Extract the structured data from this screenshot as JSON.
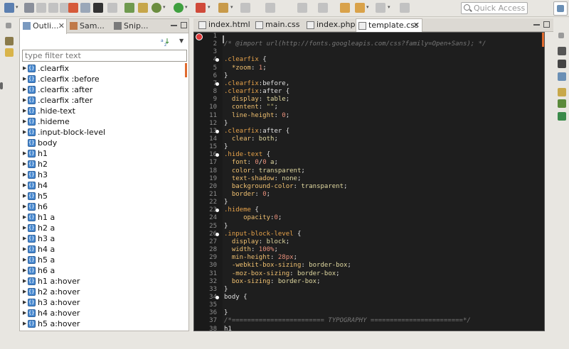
{
  "toolbar": {
    "quick_access_placeholder": "Quick Access"
  },
  "outline": {
    "tabs": [
      {
        "label": "Outli...",
        "close": "✕"
      },
      {
        "label": "Sam..."
      },
      {
        "label": "Snip..."
      }
    ],
    "filter_placeholder": "type filter text",
    "items": [
      {
        "label": ".clearfix",
        "expandable": true
      },
      {
        "label": ".clearfix :before",
        "expandable": true
      },
      {
        "label": ".clearfix :after",
        "expandable": true
      },
      {
        "label": ".clearfix :after",
        "expandable": true
      },
      {
        "label": ".hide-text",
        "expandable": true
      },
      {
        "label": ".hideme",
        "expandable": true
      },
      {
        "label": ".input-block-level",
        "expandable": true
      },
      {
        "label": "body",
        "expandable": false
      },
      {
        "label": "h1",
        "expandable": true
      },
      {
        "label": "h2",
        "expandable": true
      },
      {
        "label": "h3",
        "expandable": true
      },
      {
        "label": "h4",
        "expandable": true
      },
      {
        "label": "h5",
        "expandable": true
      },
      {
        "label": "h6",
        "expandable": true
      },
      {
        "label": "h1 a",
        "expandable": true
      },
      {
        "label": "h2 a",
        "expandable": true
      },
      {
        "label": "h3 a",
        "expandable": true
      },
      {
        "label": "h4 a",
        "expandable": true
      },
      {
        "label": "h5 a",
        "expandable": true
      },
      {
        "label": "h6 a",
        "expandable": true
      },
      {
        "label": "h1 a:hover",
        "expandable": true
      },
      {
        "label": "h2 a:hover",
        "expandable": true
      },
      {
        "label": "h3 a:hover",
        "expandable": true
      },
      {
        "label": "h4 a:hover",
        "expandable": true
      },
      {
        "label": "h5 a:hover",
        "expandable": true
      }
    ]
  },
  "editor": {
    "tabs": [
      {
        "label": "index.html"
      },
      {
        "label": "main.css"
      },
      {
        "label": "index.php"
      },
      {
        "label": "template.css",
        "active": true,
        "close": "✕"
      }
    ],
    "lines": [
      {
        "n": "1",
        "fold": false,
        "segs": []
      },
      {
        "n": "2",
        "fold": false,
        "segs": [
          [
            "c-com",
            "/* @import url(http://fonts.googleapis.com/css?family=Open+Sans); */"
          ]
        ]
      },
      {
        "n": "3",
        "fold": false,
        "segs": []
      },
      {
        "n": "4",
        "fold": true,
        "segs": [
          [
            "c-sel",
            ".clearfix"
          ],
          [
            "c-punc",
            " {"
          ]
        ]
      },
      {
        "n": "5",
        "fold": false,
        "segs": [
          [
            "c-prop",
            "  *zoom"
          ],
          [
            "c-punc",
            ": "
          ],
          [
            "c-num",
            "1"
          ],
          [
            "c-punc",
            ";"
          ]
        ]
      },
      {
        "n": "6",
        "fold": false,
        "segs": [
          [
            "c-punc",
            "}"
          ]
        ]
      },
      {
        "n": "7",
        "fold": true,
        "segs": [
          [
            "c-sel",
            ".clearfix"
          ],
          [
            "c-punc",
            ":before,"
          ]
        ]
      },
      {
        "n": "8",
        "fold": false,
        "segs": [
          [
            "c-sel",
            ".clearfix"
          ],
          [
            "c-punc",
            ":after {"
          ]
        ]
      },
      {
        "n": "9",
        "fold": false,
        "segs": [
          [
            "c-prop",
            "  display"
          ],
          [
            "c-punc",
            ": "
          ],
          [
            "c-val",
            "table"
          ],
          [
            "c-punc",
            ";"
          ]
        ]
      },
      {
        "n": "10",
        "fold": false,
        "segs": [
          [
            "c-prop",
            "  content"
          ],
          [
            "c-punc",
            ": "
          ],
          [
            "c-str",
            "\"\""
          ],
          [
            "c-punc",
            ";"
          ]
        ]
      },
      {
        "n": "11",
        "fold": false,
        "segs": [
          [
            "c-prop",
            "  line-height"
          ],
          [
            "c-punc",
            ": "
          ],
          [
            "c-num",
            "0"
          ],
          [
            "c-punc",
            ";"
          ]
        ]
      },
      {
        "n": "12",
        "fold": false,
        "segs": [
          [
            "c-punc",
            "}"
          ]
        ]
      },
      {
        "n": "13",
        "fold": true,
        "segs": [
          [
            "c-sel",
            ".clearfix"
          ],
          [
            "c-punc",
            ":after {"
          ]
        ]
      },
      {
        "n": "14",
        "fold": false,
        "segs": [
          [
            "c-prop",
            "  clear"
          ],
          [
            "c-punc",
            ": "
          ],
          [
            "c-val",
            "both"
          ],
          [
            "c-punc",
            ";"
          ]
        ]
      },
      {
        "n": "15",
        "fold": false,
        "segs": [
          [
            "c-punc",
            "}"
          ]
        ]
      },
      {
        "n": "16",
        "fold": true,
        "segs": [
          [
            "c-sel",
            ".hide-text"
          ],
          [
            "c-punc",
            " {"
          ]
        ]
      },
      {
        "n": "17",
        "fold": false,
        "segs": [
          [
            "c-prop",
            "  font"
          ],
          [
            "c-punc",
            ": "
          ],
          [
            "c-num",
            "0"
          ],
          [
            "c-punc",
            "/"
          ],
          [
            "c-num",
            "0"
          ],
          [
            "c-val",
            " a"
          ],
          [
            "c-punc",
            ";"
          ]
        ]
      },
      {
        "n": "18",
        "fold": false,
        "segs": [
          [
            "c-prop",
            "  color"
          ],
          [
            "c-punc",
            ": "
          ],
          [
            "c-val",
            "transparent"
          ],
          [
            "c-punc",
            ";"
          ]
        ]
      },
      {
        "n": "19",
        "fold": false,
        "segs": [
          [
            "c-prop",
            "  text-shadow"
          ],
          [
            "c-punc",
            ": "
          ],
          [
            "c-val",
            "none"
          ],
          [
            "c-punc",
            ";"
          ]
        ]
      },
      {
        "n": "20",
        "fold": false,
        "segs": [
          [
            "c-prop",
            "  background-color"
          ],
          [
            "c-punc",
            ": "
          ],
          [
            "c-val",
            "transparent"
          ],
          [
            "c-punc",
            ";"
          ]
        ]
      },
      {
        "n": "21",
        "fold": false,
        "segs": [
          [
            "c-prop",
            "  border"
          ],
          [
            "c-punc",
            ": "
          ],
          [
            "c-num",
            "0"
          ],
          [
            "c-punc",
            ";"
          ]
        ]
      },
      {
        "n": "22",
        "fold": false,
        "segs": [
          [
            "c-punc",
            "}"
          ]
        ]
      },
      {
        "n": "23",
        "fold": true,
        "segs": [
          [
            "c-sel",
            ".hideme"
          ],
          [
            "c-punc",
            " {"
          ]
        ]
      },
      {
        "n": "24",
        "fold": false,
        "segs": [
          [
            "c-prop",
            "     opacity"
          ],
          [
            "c-punc",
            ":"
          ],
          [
            "c-num",
            "0"
          ],
          [
            "c-punc",
            ";"
          ]
        ]
      },
      {
        "n": "25",
        "fold": false,
        "segs": [
          [
            "c-punc",
            "}"
          ]
        ]
      },
      {
        "n": "26",
        "fold": true,
        "segs": [
          [
            "c-sel",
            ".input-block-level"
          ],
          [
            "c-punc",
            " {"
          ]
        ]
      },
      {
        "n": "27",
        "fold": false,
        "segs": [
          [
            "c-prop",
            "  display"
          ],
          [
            "c-punc",
            ": "
          ],
          [
            "c-val",
            "block"
          ],
          [
            "c-punc",
            ";"
          ]
        ]
      },
      {
        "n": "28",
        "fold": false,
        "segs": [
          [
            "c-prop",
            "  width"
          ],
          [
            "c-punc",
            ": "
          ],
          [
            "c-num",
            "100%"
          ],
          [
            "c-punc",
            ";"
          ]
        ]
      },
      {
        "n": "29",
        "fold": false,
        "segs": [
          [
            "c-prop",
            "  min-height"
          ],
          [
            "c-punc",
            ": "
          ],
          [
            "c-num",
            "28px"
          ],
          [
            "c-punc",
            ";"
          ]
        ]
      },
      {
        "n": "30",
        "fold": false,
        "segs": [
          [
            "c-prop",
            "  -webkit-box-sizing"
          ],
          [
            "c-punc",
            ": "
          ],
          [
            "c-val",
            "border-box"
          ],
          [
            "c-punc",
            ";"
          ]
        ]
      },
      {
        "n": "31",
        "fold": false,
        "segs": [
          [
            "c-prop",
            "  -moz-box-sizing"
          ],
          [
            "c-punc",
            ": "
          ],
          [
            "c-val",
            "border-box"
          ],
          [
            "c-punc",
            ";"
          ]
        ]
      },
      {
        "n": "32",
        "fold": false,
        "segs": [
          [
            "c-prop",
            "  box-sizing"
          ],
          [
            "c-punc",
            ": "
          ],
          [
            "c-val",
            "border-box"
          ],
          [
            "c-punc",
            ";"
          ]
        ]
      },
      {
        "n": "33",
        "fold": false,
        "segs": [
          [
            "c-punc",
            "}"
          ]
        ]
      },
      {
        "n": "34",
        "fold": true,
        "segs": [
          [
            "c-punc",
            "body {"
          ]
        ]
      },
      {
        "n": "35",
        "fold": false,
        "segs": []
      },
      {
        "n": "36",
        "fold": false,
        "segs": [
          [
            "c-punc",
            "}"
          ]
        ]
      },
      {
        "n": "37",
        "fold": false,
        "segs": [
          [
            "c-com",
            "/*======================== TYPOGRAPHY ========================*/"
          ]
        ]
      },
      {
        "n": "38",
        "fold": false,
        "segs": [
          [
            "c-punc",
            "h1"
          ]
        ]
      }
    ]
  },
  "colors": {
    "editor_bg": "#1e1e1e",
    "selector": "#e6a24a",
    "comment": "#777777",
    "accent_marker": "#e06a2e"
  }
}
